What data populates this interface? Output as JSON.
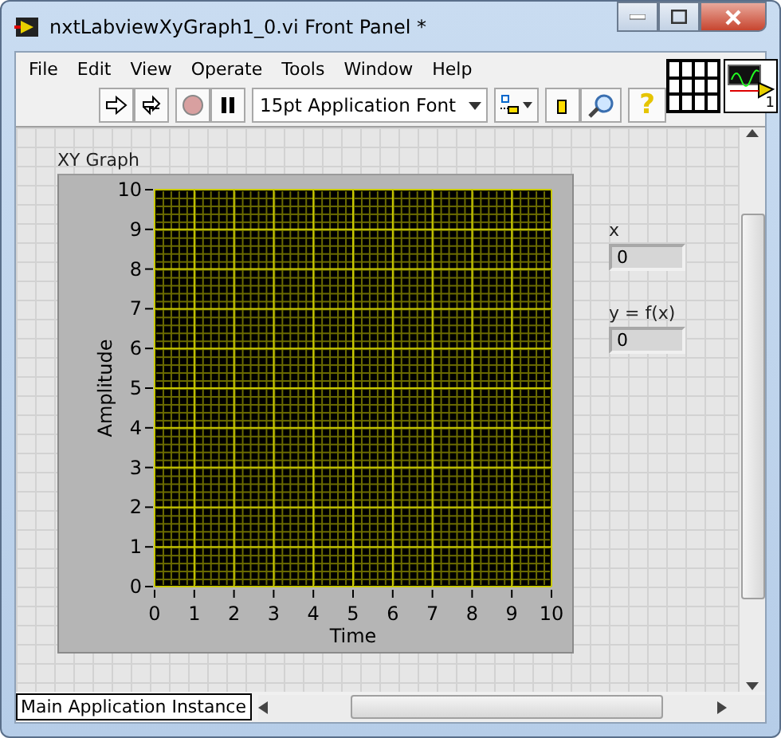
{
  "window": {
    "title": "nxtLabviewXyGraph1_0.vi Front Panel *"
  },
  "menu": [
    "File",
    "Edit",
    "View",
    "Operate",
    "Tools",
    "Window",
    "Help"
  ],
  "toolbar": {
    "font": "15pt Application Font",
    "help": "?"
  },
  "connector_pane": {
    "terminal": "1"
  },
  "graph": {
    "label": "XY Graph",
    "chart_data": {
      "type": "line",
      "xlabel": "Time",
      "ylabel": "Amplitude",
      "xlim": [
        0,
        10
      ],
      "ylim": [
        0,
        10
      ],
      "xticks": [
        0,
        1,
        2,
        3,
        4,
        5,
        6,
        7,
        8,
        9,
        10
      ],
      "yticks": [
        0,
        1,
        2,
        3,
        4,
        5,
        6,
        7,
        8,
        9,
        10
      ],
      "grid": true
    }
  },
  "indicators": [
    {
      "label": "x",
      "value": "0"
    },
    {
      "label": "y = f(x)",
      "value": "0"
    }
  ],
  "status_bar": {
    "context": "Main Application Instance"
  }
}
